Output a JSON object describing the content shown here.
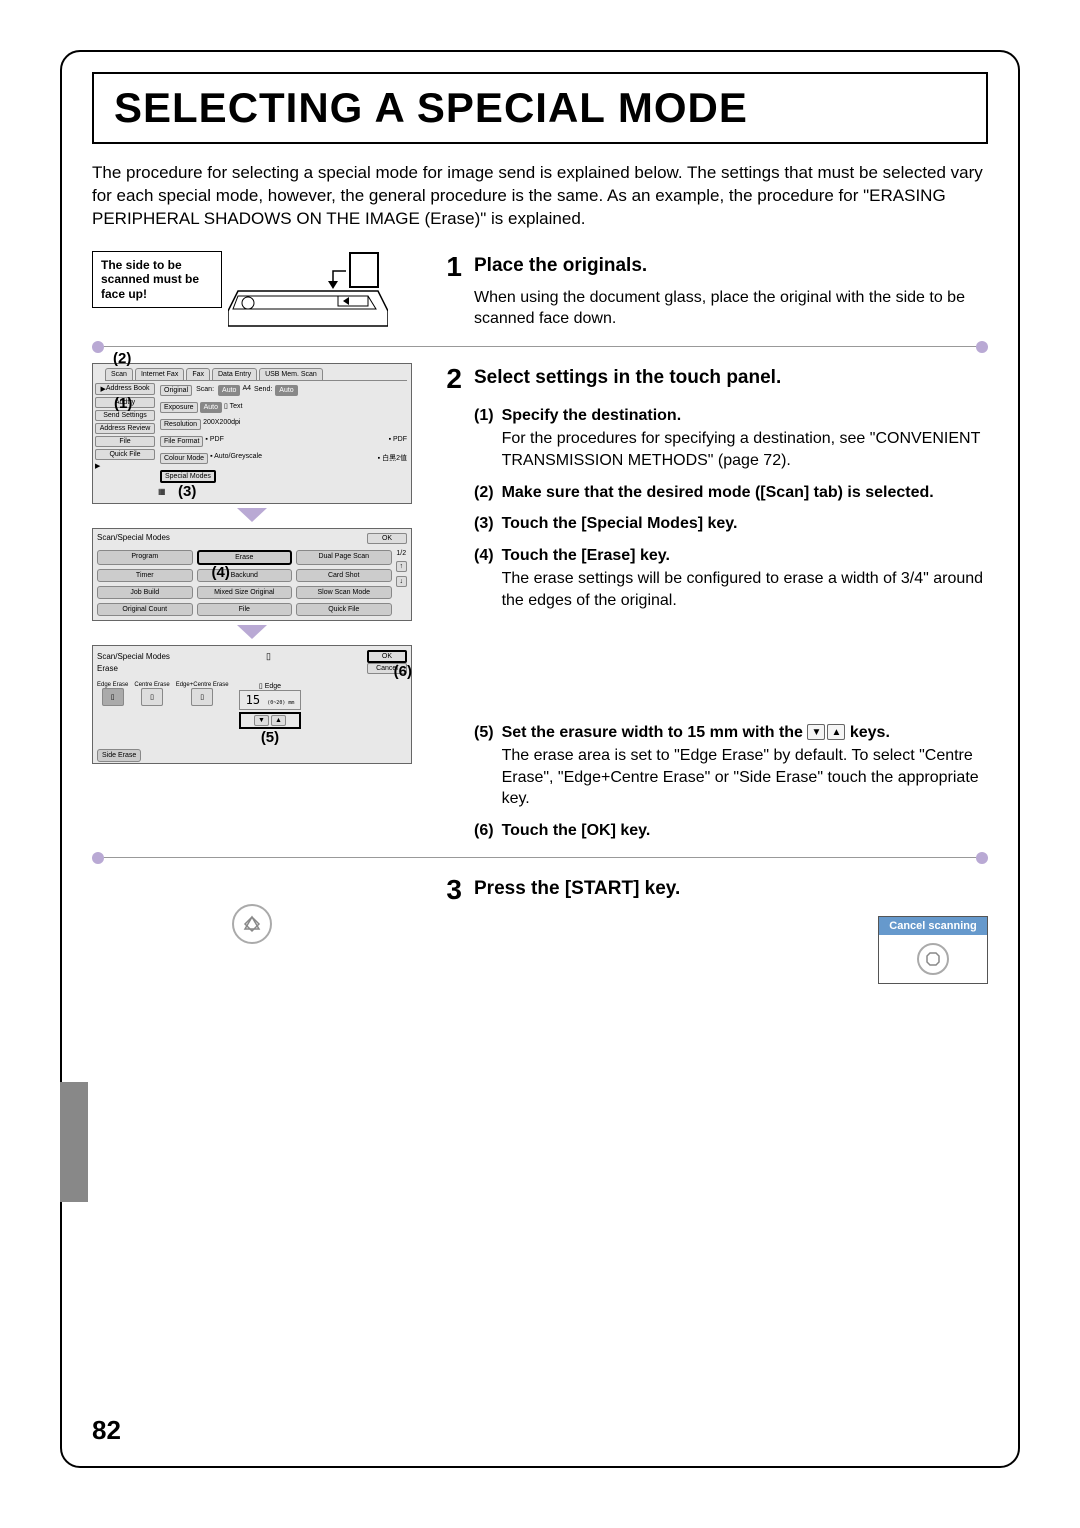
{
  "title": "SELECTING A SPECIAL MODE",
  "intro": "The procedure for selecting a special mode for image send is explained below. The settings that must be selected vary for each special mode, however, the general procedure is the same. As an example, the procedure for \"ERASING PERIPHERAL SHADOWS ON THE IMAGE (Erase)\" is explained.",
  "callout": "The side to be scanned must be face up!",
  "steps": {
    "s1": {
      "num": "1",
      "title": "Place the originals.",
      "body": "When using the document glass, place the original with the side to be scanned face down."
    },
    "s2": {
      "num": "2",
      "title": "Select settings in the touch panel.",
      "sub1": {
        "num": "(1)",
        "title": "Specify the destination.",
        "body": "For the procedures for specifying a destination, see \"CONVENIENT TRANSMISSION METHODS\" (page 72)."
      },
      "sub2": {
        "num": "(2)",
        "title": "Make sure that the desired mode ([Scan] tab) is selected."
      },
      "sub3": {
        "num": "(3)",
        "title": "Touch the [Special Modes] key."
      },
      "sub4": {
        "num": "(4)",
        "title": "Touch the [Erase] key.",
        "body": "The erase settings will be configured to erase a width of 3/4\" around the edges of the original."
      },
      "sub5": {
        "num": "(5)",
        "title_pre": "Set the erasure width to 15 mm with the ",
        "title_post": " keys.",
        "body": "The erase area is set to \"Edge Erase\" by default. To select \"Centre Erase\", \"Edge+Centre Erase\" or \"Side Erase\" touch the appropriate key."
      },
      "sub6": {
        "num": "(6)",
        "title": "Touch the [OK] key."
      }
    },
    "s3": {
      "num": "3",
      "title": "Press the [START] key.",
      "cancel": "Cancel scanning"
    }
  },
  "panel1": {
    "tabs": [
      "Scan",
      "Internet Fax",
      "Fax",
      "Data Entry",
      "USB Mem. Scan"
    ],
    "left_buttons": [
      "Address Book",
      "Address Entry",
      "Send Settings",
      "Address Review",
      "File",
      "Quick File"
    ],
    "rows": {
      "original": {
        "label": "Original",
        "scan": "Scan:",
        "auto": "Auto",
        "send": "Send:",
        "send_auto": "Auto"
      },
      "exposure": {
        "label": "Exposure",
        "auto": "Auto",
        "text": "Text"
      },
      "resolution": {
        "label": "Resolution",
        "val": "200X200dpi"
      },
      "format": {
        "label": "File Format",
        "pdf1": "PDF",
        "pdf2": "PDF"
      },
      "colour": {
        "label": "Colour Mode",
        "val1": "Auto/Greyscale",
        "val2": "白黑2值"
      },
      "special": {
        "label": "Special Modes"
      }
    },
    "num2": "(2)",
    "num1": "(1)",
    "num3": "(3)"
  },
  "panel2": {
    "title": "Scan/Special Modes",
    "ok": "OK",
    "buttons": [
      "Program",
      "Erase",
      "Dual Page Scan",
      "Timer",
      "Background",
      "Card Shot",
      "Job Build",
      "Mixed Size Original",
      "Slow Scan Mode",
      "Original Count",
      "File",
      "Quick File"
    ],
    "pager": "1/2",
    "num4": "(4)"
  },
  "panel3": {
    "title": "Scan/Special Modes",
    "subtitle": "Erase",
    "ok": "OK",
    "cancel": "Cancel",
    "types": [
      "Edge Erase",
      "Centre Erase",
      "Edge+Centre Erase",
      "Side Erase"
    ],
    "edge_label": "Edge",
    "value": "15",
    "range": "(0~20) mm",
    "num5": "(5)",
    "num6": "(6)"
  },
  "page_num": "82"
}
